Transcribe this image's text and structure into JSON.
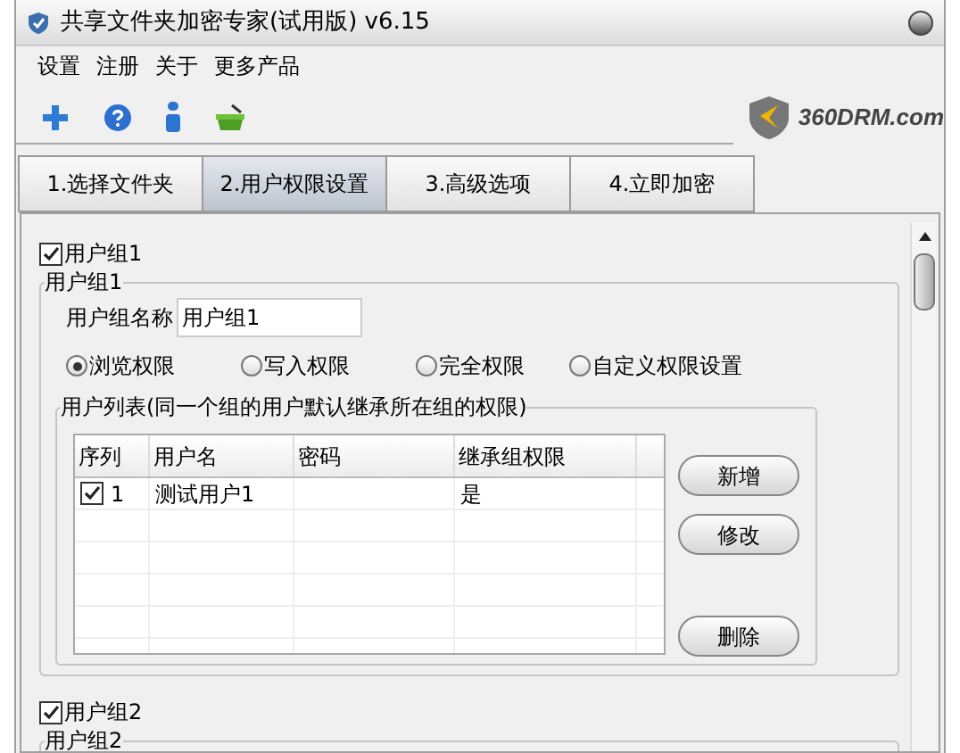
{
  "window": {
    "title": "共享文件夹加密专家(试用版) v6.15"
  },
  "menu": [
    "设置",
    "注册",
    "关于",
    "更多产品"
  ],
  "logo": {
    "text": "360DRM.com"
  },
  "tabs": [
    {
      "label": "1.选择文件夹",
      "selected": false
    },
    {
      "label": "2.用户权限设置",
      "selected": true
    },
    {
      "label": "3.高级选项",
      "selected": false
    },
    {
      "label": "4.立即加密",
      "selected": false
    }
  ],
  "groups": [
    {
      "checkbox_label": "用户组1",
      "checked": true,
      "frame_title": "用户组1",
      "name_label": "用户组名称",
      "name_value": "用户组1",
      "permissions": [
        {
          "label": "浏览权限",
          "selected": true
        },
        {
          "label": "写入权限",
          "selected": false
        },
        {
          "label": "完全权限",
          "selected": false
        },
        {
          "label": "自定义权限设置",
          "selected": false
        }
      ],
      "user_list": {
        "title": "用户列表(同一个组的用户默认继承所在组的权限)",
        "columns": [
          "序列",
          "用户名",
          "密码",
          "继承组权限"
        ],
        "rows": [
          {
            "checked": true,
            "index": "1",
            "username": "测试用户1",
            "inherit": "是"
          }
        ]
      },
      "buttons": [
        "新增",
        "修改",
        "删除"
      ]
    },
    {
      "checkbox_label": "用户组2",
      "checked": true,
      "frame_title": "用户组2"
    }
  ]
}
